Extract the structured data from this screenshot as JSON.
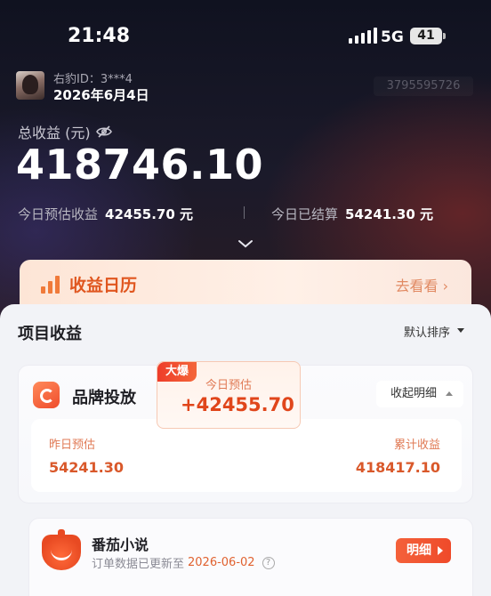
{
  "status_bar": {
    "time": "21:48",
    "network": "5G",
    "battery": "41"
  },
  "user": {
    "id_label": "右豹ID：3***4",
    "date": "2026年6月4日",
    "number": "3795595726"
  },
  "summary": {
    "total_label": "总收益 (元)",
    "total_amount": "418746.10",
    "today_est_label": "今日预估收益",
    "today_est_value": "42455.70 元",
    "today_settled_label": "今日已结算",
    "today_settled_value": "54241.30 元"
  },
  "calendar": {
    "title": "收益日历",
    "link": "去看看 ›"
  },
  "project": {
    "title": "项目收益",
    "sort_label": "默认排序"
  },
  "brand_card": {
    "name": "品牌投放",
    "collapse_label": "收起明细",
    "yesterday_label": "昨日预估",
    "yesterday_value": "54241.30",
    "badge": "大爆",
    "today_label": "今日预估",
    "today_value": "+42455.70",
    "cumulative_label": "累计收益",
    "cumulative_value": "418417.10"
  },
  "novel_card": {
    "name": "番茄小说",
    "sub_prefix": "订单数据已更新至",
    "sub_date": "2026-06-02",
    "detail_label": "明细"
  }
}
